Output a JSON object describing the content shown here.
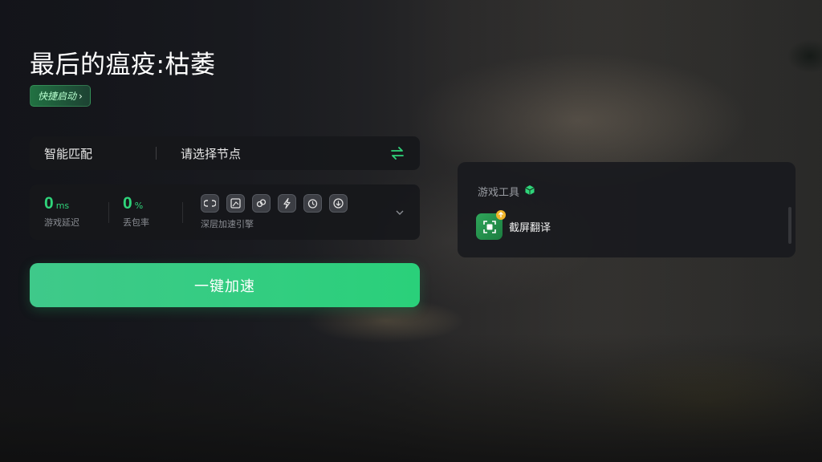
{
  "game": {
    "title": "最后的瘟疫:枯萎",
    "quick_launch_label": "快捷启动",
    "quick_launch_chevron": "›"
  },
  "node": {
    "mode": "智能匹配",
    "select_placeholder": "请选择节点"
  },
  "stats": {
    "latency": {
      "value": "0",
      "unit": "ms",
      "label": "游戏延迟"
    },
    "packet_loss": {
      "value": "0",
      "unit": "%",
      "label": "丢包率"
    },
    "engine_label": "深层加速引擎",
    "engine_icons": [
      "link-icon",
      "screen-icon",
      "chain-icon",
      "bolt-icon",
      "timer-icon",
      "download-icon"
    ]
  },
  "boost_button_label": "一键加速",
  "tools": {
    "header": "游戏工具",
    "items": [
      {
        "label": "截屏翻译",
        "icon": "screenshot-translate-icon"
      }
    ]
  },
  "colors": {
    "accent_green": "#2fd47a",
    "button_start": "#3fc98a",
    "button_end": "#2ad07a",
    "panel": "#16171b"
  }
}
